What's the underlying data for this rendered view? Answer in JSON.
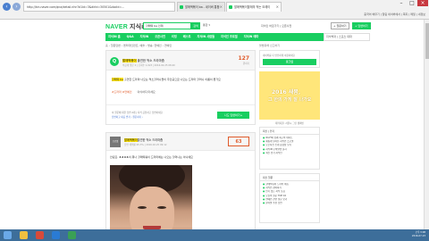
{
  "browser": {
    "address": "http://kin.naver.com/qna/detail.nhn?d1id=3&dirId=30501&docId=...",
    "tabs": [
      {
        "label": "할매떡볶이 ba - 네이버 통합"
      },
      {
        "label": "할매떡볶이할매의 먹는 도레이"
      }
    ],
    "gnb_links": "중국어 배우기 | 알림 네이버에서 | 쪽지 | 메일 | 내정보"
  },
  "header": {
    "logo_main": "NAVER",
    "logo_kin": "지식iN",
    "search_value": "할매떡 ba 인제",
    "search_button": "검색",
    "search_type": "통합 ▾",
    "right_text": "지식인 바로가기 | 오픈사전",
    "write_button": "+ 질문하기",
    "answer_button": "+ 답변하기"
  },
  "nav": {
    "items": [
      "지식iN 홈",
      "Q&A",
      "지식iN",
      "오픈사전",
      "리빙",
      "베스트",
      "지식iN 사람들",
      "지식인 프로필",
      "지식iN 테마"
    ],
    "right": "지식백과 | 스포츠 대화"
  },
  "breadcrumb": {
    "path": "홈 › 질문답변 › 엔터테인먼트, 예술 › 방송, 연예인 › 연예인",
    "right": "불법유해 신고하기"
  },
  "question": {
    "icon": "Q",
    "title_hl": "할매떡볶이",
    "title_rest": " 출연한 먹소 드라마좀",
    "sub": "비공개 질문 2 | 조회수 1,023 | 2016.02.25 08:40",
    "votes": "127",
    "votes_label": "원하기",
    "body_hl": "할매떡 ba",
    "body": " 출연한 드라마 나오는 먹소할머니들이 주인공으로 나오는 드라마 할머니 이름이 뭔가요",
    "tags": "#드라마 #연예인",
    "tags_extra": "의식하지 마세요",
    "foot_note": "이 질문에 대한 답변 2개 | 지식 공유하고 답변하세요",
    "foot_link": "답변하고 내공 받기 › 질문하기 ›",
    "answer_button": "나도 답변하기 ▸"
  },
  "answer": {
    "avatar": "프로필",
    "title_hl": "할매떡볶이",
    "title_rest": "출연한 먹소 드라마좀",
    "sub": "답변 채택률 95.3% | 2016.02.25 09:12",
    "votes": "63",
    "body": "안녕요. ♠♠♠♠이 뭐나 할매떡볶이 드라마에는 나오는 할머니는 아니에요"
  },
  "sidebar": {
    "login_hint": "네이버를 더 안전하게 이용하세요",
    "login_button": "로그인",
    "banner_line1": "2016 새봄,",
    "banner_line2": "그 한의 가게 잘 나가요",
    "banner_caption": "제작지원: 서울시 그린 캠페인",
    "box1_tab": "최신 | 인기",
    "box1_items": [
      "Wi-Fi와 함께 최고의 데이트",
      "새롭게 달라진 지식인 프로필",
      "오픈사전 소개 동영상 보기",
      "지식iN 모바일앱 출시",
      "최신 인기 지식인"
    ],
    "box2_tab": "최신 질문",
    "box2_items": [
      "할매떡볶이 드라마 이름",
      "지식인 참여하기",
      "인기 있는 지식 모음",
      "오늘의 질문 TOP 10",
      "연예인 관련 질문 보기",
      "분야별 추천 답변"
    ]
  },
  "taskbar": {
    "time": "오후 3:08",
    "date": "2016-07-23"
  },
  "colors": {
    "naver_green": "#19ce60",
    "accent_orange": "#e05b2b",
    "taskbar_blue": "#3d6e9a"
  }
}
